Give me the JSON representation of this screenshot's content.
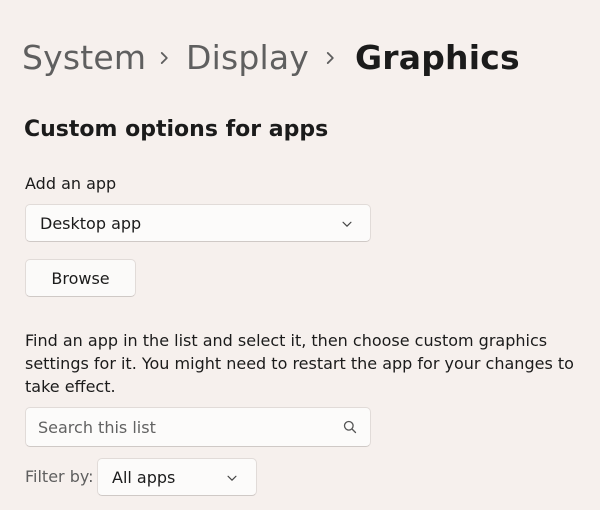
{
  "breadcrumb": {
    "items": [
      "System",
      "Display",
      "Graphics"
    ]
  },
  "custom_options": {
    "title": "Custom options for apps",
    "add_app_label": "Add an app",
    "app_type_selected": "Desktop app",
    "browse_label": "Browse",
    "description": "Find an app in the list and select it, then choose custom graphics settings for it. You might need to restart the app for your changes to take effect.",
    "search_placeholder": "Search this list",
    "filter_label": "Filter by:",
    "filter_selected": "All apps"
  },
  "icons": {
    "breadcrumb_separator": "chevron-right-icon",
    "dropdown": "chevron-down-icon",
    "search": "search-icon"
  },
  "colors": {
    "background": "#f6f0ed",
    "control_background": "#fcfbfa",
    "text_primary": "#1b1b1b",
    "text_secondary": "#5f5f5f"
  }
}
